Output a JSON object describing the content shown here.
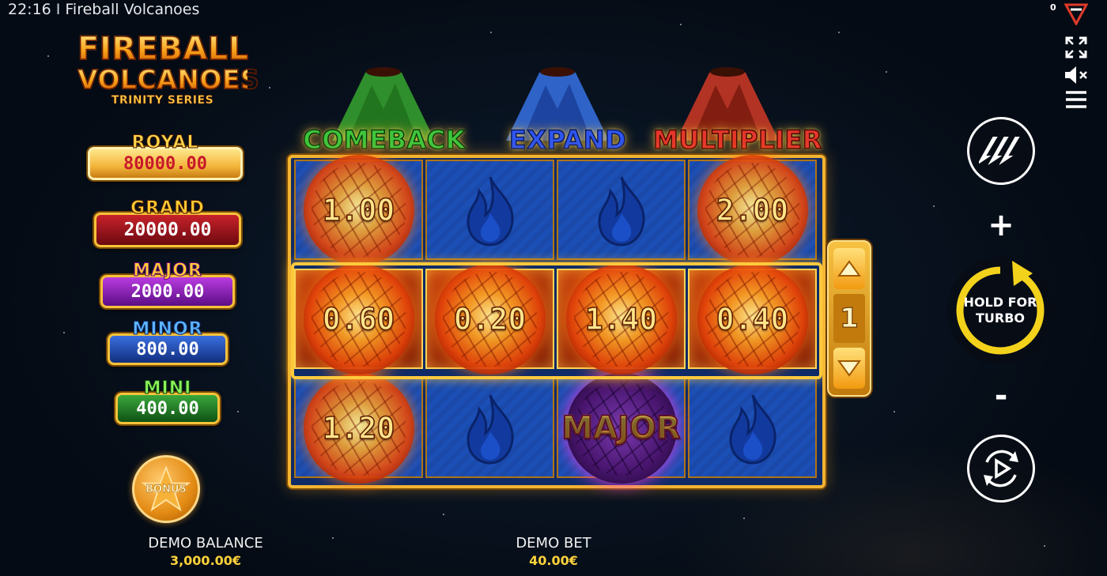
{
  "status_bar": {
    "time": "22:16",
    "separator": "I",
    "title": "Fireball Volcanoes"
  },
  "logo": {
    "line1": "FIREBALL",
    "line2": "VOLCANOES",
    "line3": "TRINITY SERIES"
  },
  "jackpots": [
    {
      "id": "royal",
      "label": "ROYAL",
      "value": "80000.00"
    },
    {
      "id": "grand",
      "label": "GRAND",
      "value": "20000.00"
    },
    {
      "id": "major",
      "label": "MAJOR",
      "value": "2000.00"
    },
    {
      "id": "minor",
      "label": "MINOR",
      "value": "800.00"
    },
    {
      "id": "mini",
      "label": "MINI",
      "value": "400.00"
    }
  ],
  "bonus": {
    "label": "BONUS"
  },
  "features": {
    "green": "COMEBACK",
    "blue": "EXPAND",
    "red": "MULTIPLIER"
  },
  "grid": {
    "rows": [
      [
        {
          "type": "fireball",
          "value": "1.00"
        },
        {
          "type": "blank"
        },
        {
          "type": "blank"
        },
        {
          "type": "fireball",
          "value": "2.00"
        }
      ],
      [
        {
          "type": "fireball",
          "value": "0.60"
        },
        {
          "type": "fireball",
          "value": "0.20"
        },
        {
          "type": "fireball",
          "value": "1.40"
        },
        {
          "type": "fireball",
          "value": "0.40"
        }
      ],
      [
        {
          "type": "fireball",
          "value": "1.20"
        },
        {
          "type": "blank"
        },
        {
          "type": "jackpot",
          "value": "MAJOR"
        },
        {
          "type": "blank"
        }
      ]
    ],
    "lit_row": 1
  },
  "row_selector": {
    "value": "1"
  },
  "bottom": {
    "balance_label": "DEMO BALANCE",
    "balance_value": "3,000.00€",
    "bet_label": "DEMO BET",
    "bet_value": "40.00€"
  },
  "controls": {
    "counter": "0",
    "spin_label": "HOLD FOR TURBO",
    "plus": "+",
    "minus": "-"
  },
  "colors": {
    "accent": "#f2b432",
    "spin_arrow": "#f3d21c",
    "balance_value": "#ffd23a"
  }
}
